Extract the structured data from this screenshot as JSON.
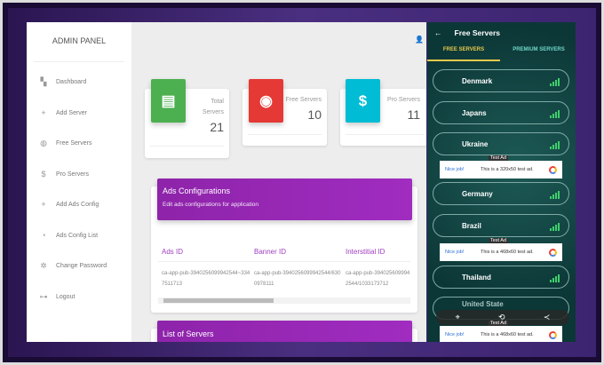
{
  "sidebar": {
    "title": "ADMIN PANEL",
    "items": [
      {
        "label": "Dashboard",
        "icon": "▚"
      },
      {
        "label": "Add Server",
        "icon": "+"
      },
      {
        "label": "Free Servers",
        "icon": "◍"
      },
      {
        "label": "Pro Servers",
        "icon": "$"
      },
      {
        "label": "Add Ads Config",
        "icon": "+"
      },
      {
        "label": "Ads Config List",
        "icon": "◔"
      },
      {
        "label": "Change Password",
        "icon": "✲"
      },
      {
        "label": "Logout",
        "icon": "⊶"
      }
    ]
  },
  "header": {
    "user_icon": "👤"
  },
  "stats": [
    {
      "label": "Total Servers",
      "value": "21",
      "color": "#4caf50",
      "icon": "▤"
    },
    {
      "label": "Free Servers",
      "value": "10",
      "color": "#e53935",
      "icon": "◉"
    },
    {
      "label": "Pro Servers",
      "value": "11",
      "color": "#00bcd4",
      "icon": "$"
    }
  ],
  "ads_config": {
    "title": "Ads Configurations",
    "subtitle": "Edit ads configurations for application",
    "columns": [
      "Ads ID",
      "Banner ID",
      "Interstitial ID"
    ],
    "row": [
      "ca-app-pub-3940256099942544~3347511713",
      "ca-app-pub-3940256099942544/6300978111",
      "ca-app-pub-3940256099942544/1033173712"
    ]
  },
  "list_servers": {
    "title": "List of Servers"
  },
  "phone": {
    "title": "Free Servers",
    "tabs": [
      "FREE SERVERS",
      "PREMIUM SERVERS"
    ],
    "servers": [
      "Denmark",
      "Japans",
      "Ukraine",
      "Germany",
      "Brazil",
      "Thailand",
      "United State"
    ],
    "ads": [
      {
        "tag": "Test Ad",
        "nice": "Nice job!",
        "text": "This is a 320x50 test ad."
      },
      {
        "tag": "Test Ad",
        "nice": "Nice job!",
        "text": "This is a 468x60 test ad."
      },
      {
        "tag": "Test Ad",
        "nice": "Nice job!",
        "text": "This is a 468x60 test ad."
      }
    ]
  }
}
